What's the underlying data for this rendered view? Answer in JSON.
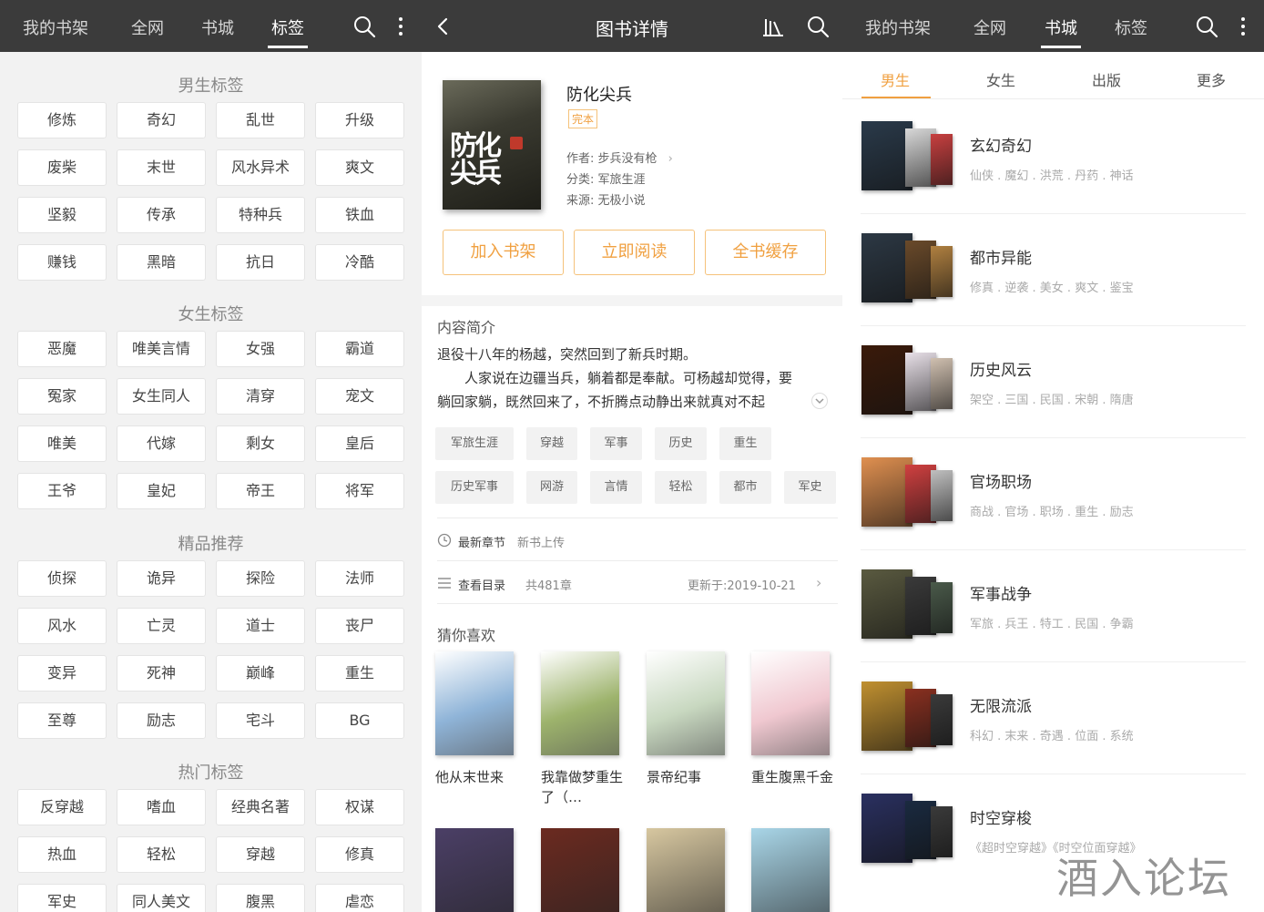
{
  "p1": {
    "tabs": [
      "我的书架",
      "全网",
      "书城",
      "标签"
    ],
    "active_tab": 3,
    "sections": [
      {
        "title": "男生标签",
        "tags": [
          "修炼",
          "奇幻",
          "乱世",
          "升级",
          "废柴",
          "末世",
          "风水异术",
          "爽文",
          "坚毅",
          "传承",
          "特种兵",
          "铁血",
          "赚钱",
          "黑暗",
          "抗日",
          "冷酷"
        ]
      },
      {
        "title": "女生标签",
        "tags": [
          "恶魔",
          "唯美言情",
          "女强",
          "霸道",
          "冤家",
          "女生同人",
          "清穿",
          "宠文",
          "唯美",
          "代嫁",
          "剩女",
          "皇后",
          "王爷",
          "皇妃",
          "帝王",
          "将军"
        ]
      },
      {
        "title": "精品推荐",
        "tags": [
          "侦探",
          "诡异",
          "探险",
          "法师",
          "风水",
          "亡灵",
          "道士",
          "丧尸",
          "变异",
          "死神",
          "巅峰",
          "重生",
          "至尊",
          "励志",
          "宅斗",
          "BG"
        ]
      },
      {
        "title": "热门标签",
        "tags": [
          "反穿越",
          "嗜血",
          "经典名著",
          "权谋",
          "热血",
          "轻松",
          "穿越",
          "修真",
          "军史",
          "同人美文",
          "腹黑",
          "虐恋"
        ]
      }
    ]
  },
  "p2": {
    "title": "图书详情",
    "book": {
      "cover_text": "防化尖兵",
      "name": "防化尖兵",
      "status": "完本",
      "author": "作者: 步兵没有枪",
      "category": "分类: 军旅生涯",
      "source": "来源: 无极小说"
    },
    "buttons": [
      "加入书架",
      "立即阅读",
      "全书缓存"
    ],
    "intro_heading": "内容简介",
    "intro_line1": "退役十八年的杨越，突然回到了新兵时期。",
    "intro_line2": "人家说在边疆当兵，躺着都是奉献。可杨越却觉得，要",
    "intro_line3": "躺回家躺，既然回来了，不折腾点动静出来就真对不起",
    "tags": [
      "军旅生涯",
      "穿越",
      "军事",
      "历史",
      "重生",
      "历史军事",
      "网游",
      "言情",
      "轻松",
      "都市",
      "军史"
    ],
    "latest_label": "最新章节",
    "latest_value": "新书上传",
    "catalog_label": "查看目录",
    "catalog_count": "共481章",
    "updated": "更新于:2019-10-21",
    "recommend_heading": "猜你喜欢",
    "recommend": [
      {
        "name": "他从末世来",
        "color": "#8fb4d8"
      },
      {
        "name": "我靠做梦重生了（…",
        "color": "#9db36c"
      },
      {
        "name": "景帝纪事",
        "color": "#c8d8c0"
      },
      {
        "name": "重生腹黑千金",
        "color": "#f0c8d0"
      }
    ],
    "recommend_row2_colors": [
      "#4b3f66",
      "#6b2a20",
      "#d7c7a0",
      "#a9d6e8"
    ]
  },
  "p3": {
    "tabs": [
      "我的书架",
      "全网",
      "书城",
      "标签"
    ],
    "active_tab": 2,
    "subtabs": [
      "男生",
      "女生",
      "出版",
      "更多"
    ],
    "active_subtab": 0,
    "categories": [
      {
        "name": "玄幻奇幻",
        "sub": "仙侠 . 魔幻 . 洪荒 . 丹药 . 神话",
        "colors": [
          "#2a3a4a",
          "#d8d8d8",
          "#c84040"
        ]
      },
      {
        "name": "都市异能",
        "sub": "修真 . 逆袭 . 美女 . 爽文 . 鉴宝",
        "colors": [
          "#2c3844",
          "#6a4a2a",
          "#b08040"
        ]
      },
      {
        "name": "历史风云",
        "sub": "架空 . 三国 . 民国 . 宋朝 . 隋唐",
        "colors": [
          "#3a1a0a",
          "#e8e0e8",
          "#d0c0b0"
        ]
      },
      {
        "name": "官场职场",
        "sub": "商战 . 官场 . 职场 . 重生 . 励志",
        "colors": [
          "#e09050",
          "#d04040",
          "#c0c0c0"
        ]
      },
      {
        "name": "军事战争",
        "sub": "军旅 . 兵王 . 特工 . 民国 . 争霸",
        "colors": [
          "#5a5a40",
          "#3a3a3a",
          "#4a5a4a"
        ]
      },
      {
        "name": "无限流派",
        "sub": "科幻 . 末来 . 奇遇 . 位面 . 系统",
        "colors": [
          "#c09030",
          "#8a3020",
          "#3a3a3a"
        ]
      },
      {
        "name": "时空穿梭",
        "sub": "《超时空穿越》《时空位面穿越》",
        "colors": [
          "#2a3060",
          "#1a2a40",
          "#3a3a3a"
        ]
      }
    ]
  },
  "watermark": "酒入论坛"
}
